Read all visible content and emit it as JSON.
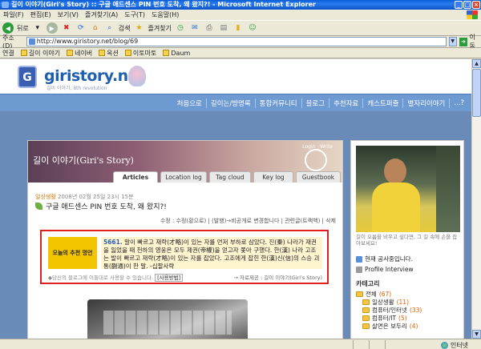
{
  "window": {
    "title": "길이 이야기(Giri's Story) :: 구글 애드센스 PIN 번호 도착, 왜 왔지?! - Microsoft Internet Explorer",
    "min": "_",
    "max": "□",
    "close": "×"
  },
  "menu": [
    "파일(F)",
    "편집(E)",
    "보기(V)",
    "즐겨찾기(A)",
    "도구(T)",
    "도움말(H)"
  ],
  "toolbar": {
    "back_label": "뒤로",
    "search_label": "검색",
    "favorites_label": "즐겨찾기"
  },
  "address": {
    "label": "주소(D)",
    "url": "http://www.giristory.net/blog/69",
    "go_label": "이동"
  },
  "links": {
    "label": "연결",
    "items": [
      "길이 이야기",
      "네이버",
      "옥션",
      "이토마토",
      "Daum"
    ]
  },
  "site": {
    "logo_letter": "G",
    "logo_text": "giristory.net",
    "logo_sub": "길이 이야기, 8th revolution",
    "nav": [
      "처음으로",
      "길이는/방명록",
      "통합커뮤니티",
      "블로그",
      "추천자료",
      "캐스트퍼즐",
      "별자리이야기",
      "...?"
    ]
  },
  "blog": {
    "title": "길이 이야기(Giri's Story)",
    "head_labels": "Login  ·  Write",
    "tabs": [
      "Articles",
      "Location log",
      "Tag cloud",
      "Key log",
      "Guestbook"
    ],
    "active_tab": 0
  },
  "post": {
    "category": "일상생활",
    "date": "2008년 02월 25일 23시 15분",
    "title": "구글 애드센스 PIN 번호 도착, 왜 왔지?!",
    "actions": "수정 : 수정(황으로) | (발행)→비공개로 변경합니다 | 관련글(트랙백) | 삭제"
  },
  "quote": {
    "label": "오늘의 추천 명언",
    "number": "5661.",
    "text": "말이 빠르고 재략(才略)이 있는 자를 먼저 부하로 삼았다. 진(秦) 나라가 재권을 잃었을 때 천하의 영웅은 모두 제권(帝權)을 얻고자 쫓아 구했다. 한(漢) 나라 고조는 발이 빠르고 재략(才略)이 있는 자를 잡았다. 고조에게 잡힌 한(漢)신(信)의 스승 괴통(蒯通)이 한 말. -십팔사략",
    "footer": "◆당신의 블로그에 이들대로 사용할 수 있습니다.",
    "footer_btn": "[사용방법]",
    "by": "→ 자료제공 : 길이 이야기(Giri's Story)"
  },
  "sidebar": {
    "profile_desc": "길이 오름을 비우고 싶다면, 그 길 속에 손을 잡아보세요!",
    "notice": "현재 공사중입니다.",
    "interview": "Profile Interview",
    "category_heading": "카테고리",
    "categories": [
      {
        "name": "전체",
        "count": "(67)",
        "sub": false
      },
      {
        "name": "일상생활",
        "count": "(11)",
        "sub": true
      },
      {
        "name": "컴퓨터/인터넷",
        "count": "(33)",
        "sub": true
      },
      {
        "name": "컴퓨터/IT",
        "count": "(5)",
        "sub": true
      },
      {
        "name": "살면은 보두리",
        "count": "(4)",
        "sub": true
      }
    ]
  },
  "status": {
    "zone": "인터넷"
  }
}
